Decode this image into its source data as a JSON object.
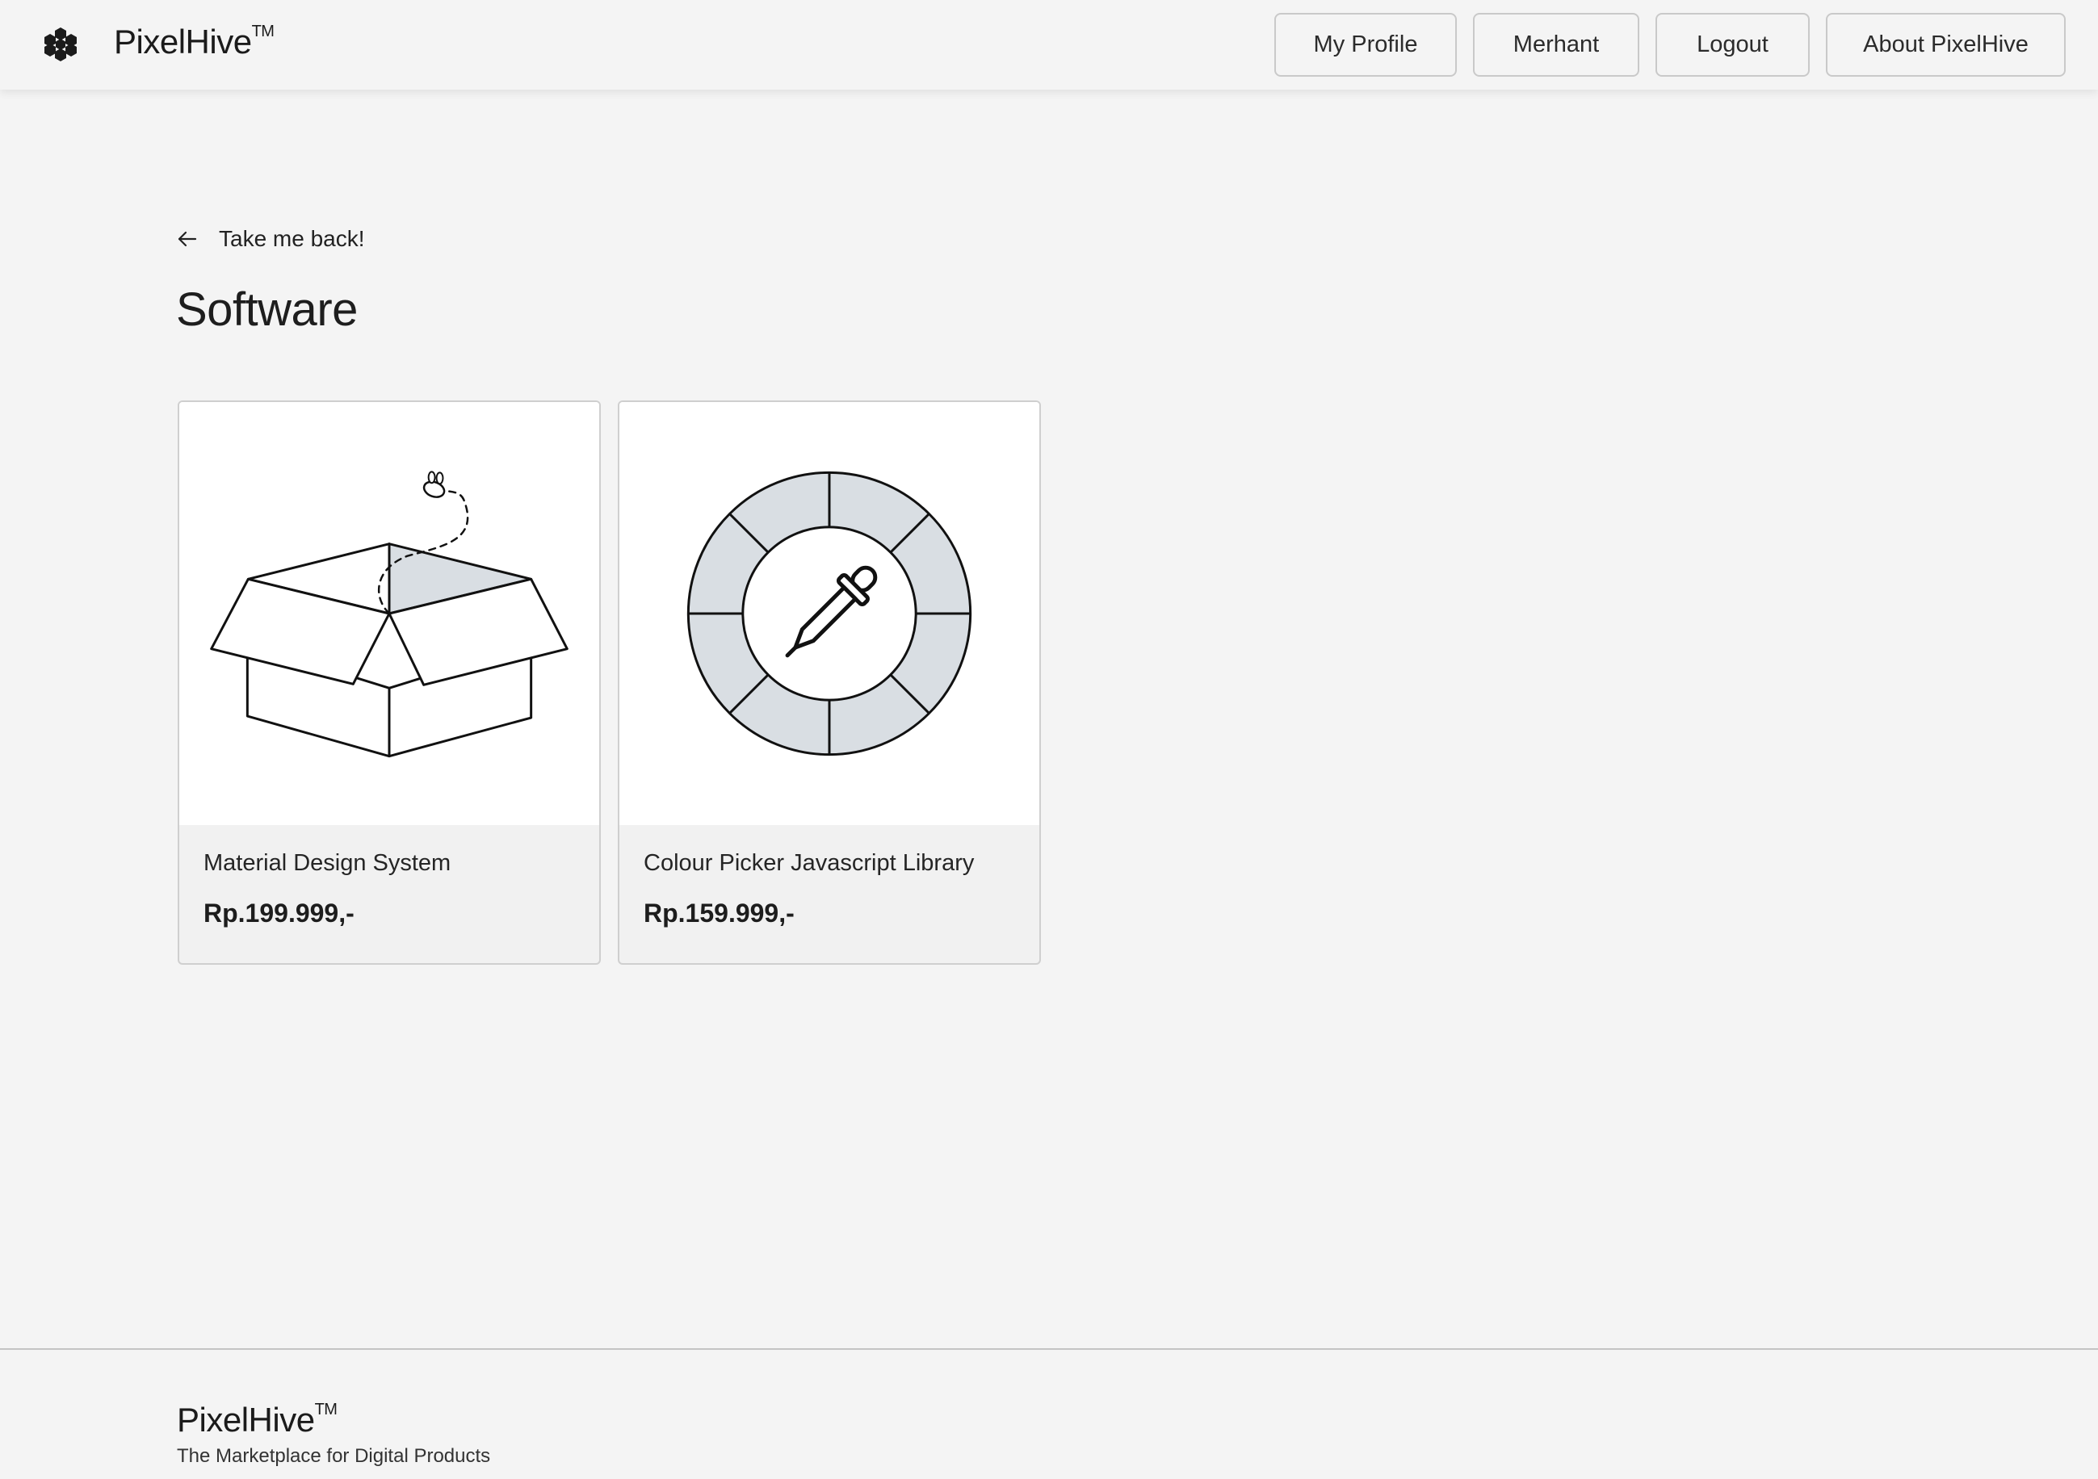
{
  "header": {
    "brand": "PixelHive",
    "brand_mark": "TM",
    "logo_icon": "hexagon-cluster-icon",
    "nav": [
      {
        "label": "My Profile"
      },
      {
        "label": "Merhant"
      },
      {
        "label": "Logout"
      },
      {
        "label": "About PixelHive"
      }
    ]
  },
  "main": {
    "back_label": "Take me back!",
    "back_icon": "arrow-left-icon",
    "title": "Software",
    "products": [
      {
        "name": "Material Design System",
        "price": "Rp.199.999,-",
        "image_icon": "open-box-with-bee-icon"
      },
      {
        "name": "Colour Picker Javascript Library",
        "price": "Rp.159.999,-",
        "image_icon": "color-wheel-eyedropper-icon"
      }
    ]
  },
  "footer": {
    "brand": "PixelHive",
    "brand_mark": "TM",
    "tagline": "The Marketplace for Digital Products"
  },
  "colors": {
    "background": "#f4f4f4",
    "card_image_bg": "#ffffff",
    "illustration_fill": "#d9dee3",
    "text": "#1b1b1b"
  }
}
